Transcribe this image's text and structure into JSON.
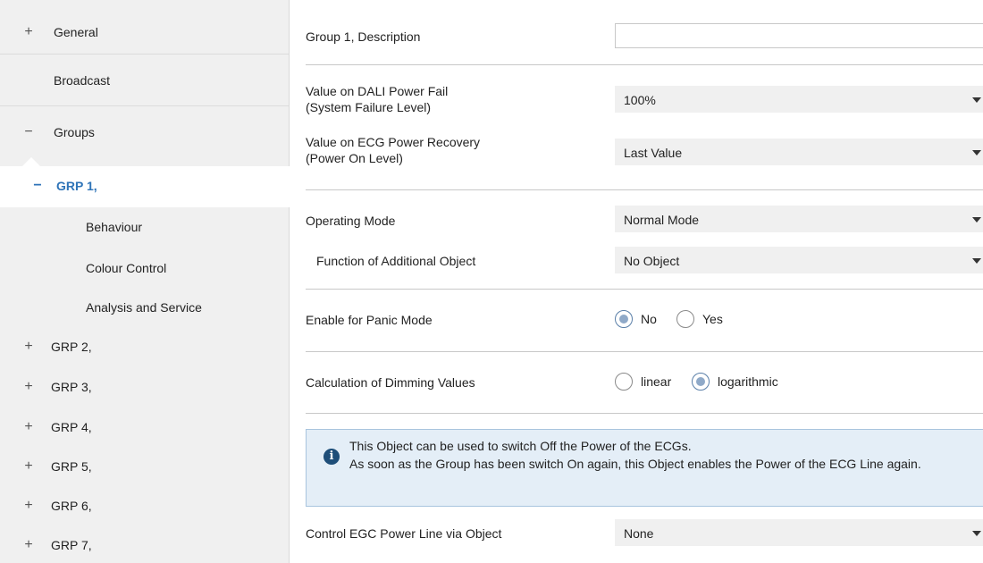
{
  "sidebar": {
    "general": {
      "sign": "+",
      "label": "General"
    },
    "broadcast": {
      "label": "Broadcast"
    },
    "groups": {
      "sign": "−",
      "label": "Groups"
    },
    "active_group": {
      "sign": "−",
      "label": "GRP 1,"
    },
    "sub_items": [
      "Behaviour",
      "Colour Control",
      "Analysis and Service"
    ],
    "groups_list": [
      {
        "sign": "+",
        "label": "GRP 2,"
      },
      {
        "sign": "+",
        "label": "GRP 3,"
      },
      {
        "sign": "+",
        "label": "GRP 4,"
      },
      {
        "sign": "+",
        "label": "GRP 5,"
      },
      {
        "sign": "+",
        "label": "GRP 6,"
      },
      {
        "sign": "+",
        "label": "GRP 7,"
      }
    ]
  },
  "main": {
    "description": {
      "label": "Group 1, Description",
      "value": ""
    },
    "power_fail": {
      "label_line1": "Value on DALI Power Fail",
      "label_line2": "(System Failure Level)",
      "value": "100%"
    },
    "power_recovery": {
      "label_line1": "Value on ECG Power Recovery",
      "label_line2": "(Power On Level)",
      "value": "Last Value"
    },
    "operating_mode": {
      "label": "Operating Mode",
      "value": "Normal Mode"
    },
    "additional_object": {
      "label": "Function of Additional Object",
      "value": "No Object"
    },
    "panic_mode": {
      "label": "Enable for Panic Mode",
      "options": [
        "No",
        "Yes"
      ],
      "selected": "No"
    },
    "dimming": {
      "label": "Calculation of Dimming Values",
      "options": [
        "linear",
        "logarithmic"
      ],
      "selected": "logarithmic"
    },
    "info": {
      "icon": "info-icon",
      "line1": "This Object can be used to switch Off the Power of the ECGs.",
      "line2": "As soon as the Group has been switch On again, this Object enables the Power of the ECG Line again."
    },
    "power_line": {
      "label": "Control EGC Power Line via Object",
      "value": "None"
    }
  }
}
